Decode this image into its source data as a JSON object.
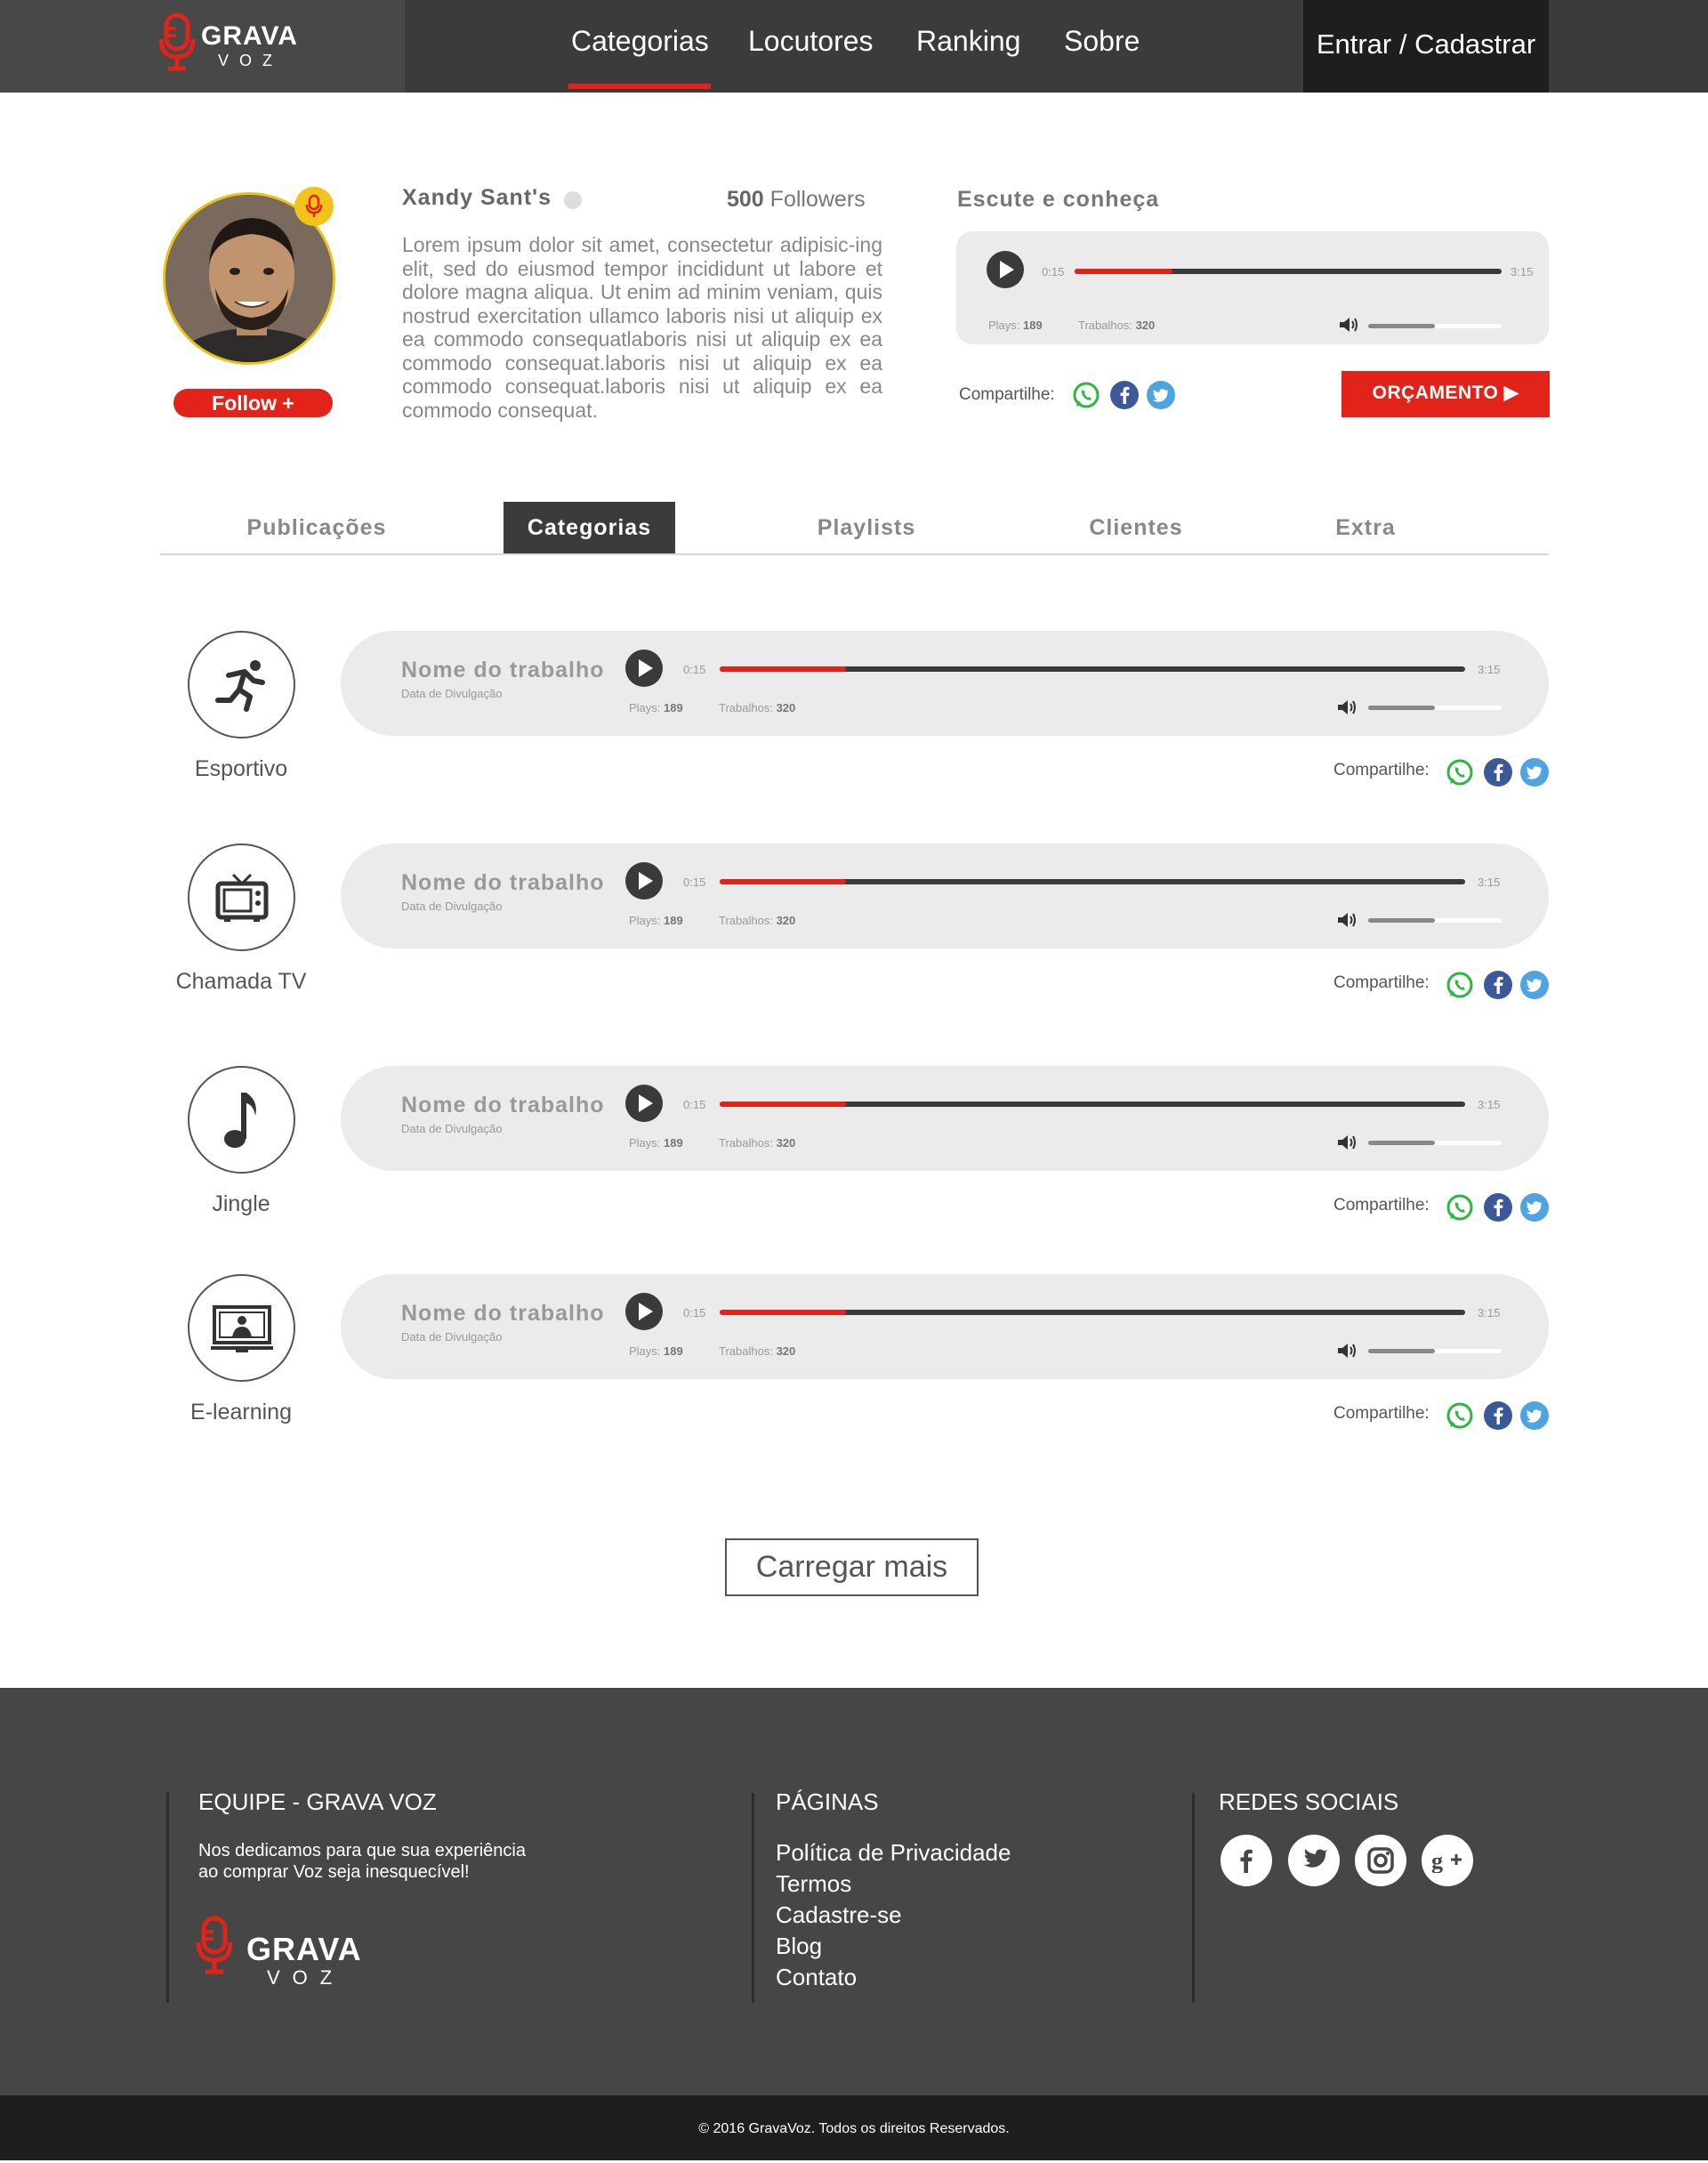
{
  "header": {
    "logo_text": "GRAVA",
    "logo_sub": "VOZ",
    "nav": [
      "Categorias",
      "Locutores",
      "Ranking",
      "Sobre"
    ],
    "login_label": "Entrar / Cadastrar"
  },
  "profile": {
    "name": "Xandy Sant's",
    "followers_count": "500",
    "followers_label": "Followers",
    "follow_label": "Follow +",
    "bio": "Lorem ipsum dolor sit amet, consectetur adipisic-ing elit, sed do eiusmod tempor incididunt ut labore et dolore magna aliqua. Ut enim ad minim veniam, quis nostrud exercitation ullamco laboris nisi ut aliquip ex ea commodo consequatlaboris nisi ut aliquip ex ea commodo consequat.laboris nisi ut aliquip ex ea commodo consequat.laboris nisi ut aliquip ex ea commodo consequat."
  },
  "featured_player": {
    "title": "Escute e conheça",
    "time_current": "0:15",
    "time_total": "3:15",
    "progress": 0.23,
    "volume": 0.5,
    "plays_label": "Plays:",
    "plays_value": "189",
    "works_label": "Trabalhos:",
    "works_value": "320",
    "share_label": "Compartilhe:",
    "budget_label": "ORÇAMENTO ▶"
  },
  "tabs": [
    "Publicações",
    "Categorias",
    "Playlists",
    "Clientes",
    "Extra"
  ],
  "active_tab": "Categorias",
  "categories": [
    {
      "label": "Esportivo",
      "icon": "running-person-icon"
    },
    {
      "label": "Chamada TV",
      "icon": "tv-icon"
    },
    {
      "label": "Jingle",
      "icon": "music-note-icon"
    },
    {
      "label": "E-learning",
      "icon": "monitor-teacher-icon"
    }
  ],
  "track": {
    "title": "Nome do trabalho",
    "date": "Data de Divulgação",
    "time_current": "0:15",
    "time_total": "3:15",
    "progress": 0.17,
    "volume": 0.5,
    "plays_label": "Plays:",
    "plays_value": "189",
    "works_label": "Trabalhos:",
    "works_value": "320",
    "share_label": "Compartilhe:"
  },
  "load_more_label": "Carregar mais",
  "footer": {
    "team_title": "EQUIPE - GRAVA VOZ",
    "team_text": "Nos dedicamos para que sua experiência\nao comprar Voz seja inesquecível!",
    "pages_title": "PÁGINAS",
    "pages": [
      "Política de Privacidade",
      "Termos",
      "Cadastre-se",
      "Blog",
      "Contato"
    ],
    "social_title": "REDES SOCIAIS",
    "social_icons": [
      "facebook-icon",
      "twitter-icon",
      "instagram-icon",
      "google-plus-icon"
    ],
    "copyright": "© 2016 GravaVoz. Todos os direitos Reservados."
  },
  "colors": {
    "accent": "#e2231a",
    "header": "#3b3b3b",
    "footer": "#464646",
    "badge": "#f2c318"
  }
}
